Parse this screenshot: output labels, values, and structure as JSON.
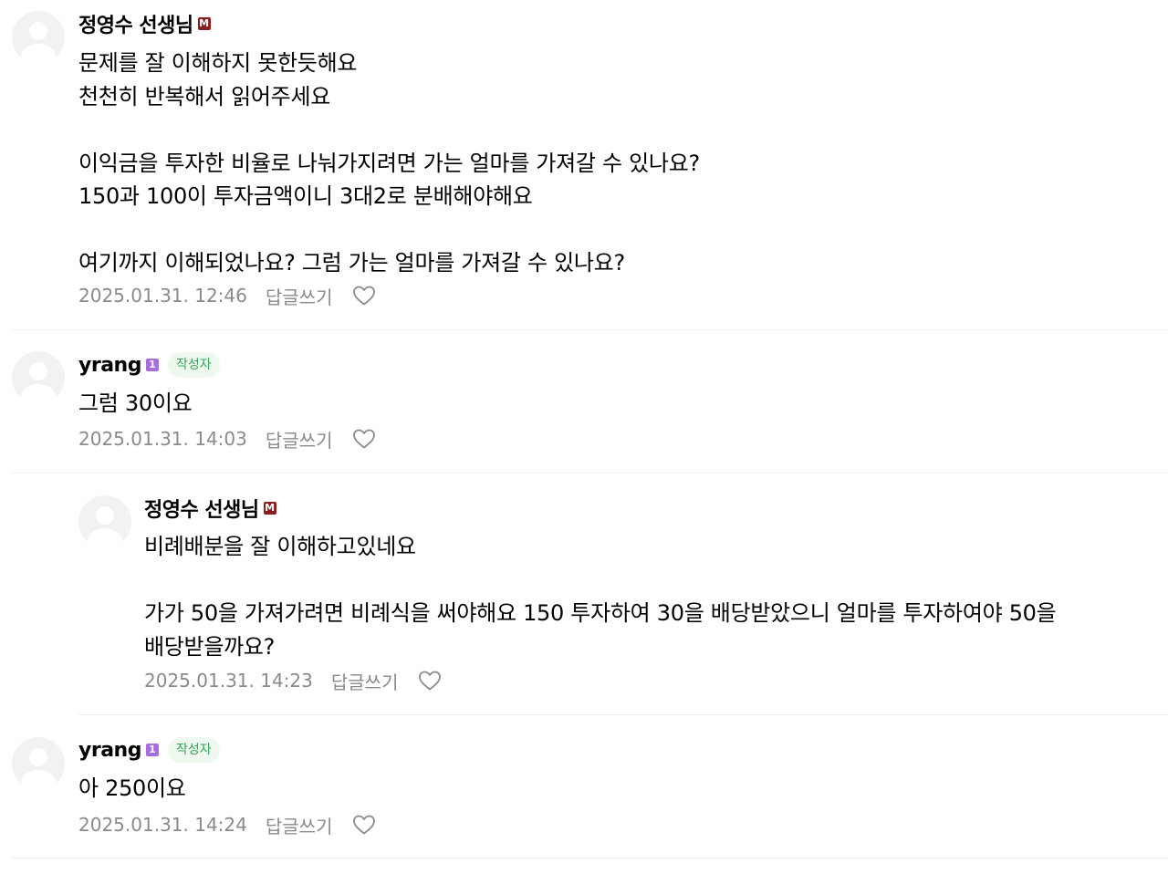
{
  "comments": [
    {
      "author": "정영수 선생님",
      "badge": "M",
      "body": "문제를 잘 이해하지 못한듯해요\n천천히 반복해서 읽어주세요\n\n이익금을 투자한 비율로 나눠가지려면 가는 얼마를 가져갈 수 있나요?\n150과 100이 투자금액이니 3대2로 분배해야해요\n\n여기까지 이해되었나요? 그럼 가는 얼마를 가져갈 수 있나요?",
      "date": "2025.01.31. 12:46",
      "reply_label": "답글쓰기"
    },
    {
      "author": "yrang",
      "badge": "1",
      "writer_tag": "작성자",
      "body": "그럼 30이요",
      "date": "2025.01.31. 14:03",
      "reply_label": "답글쓰기"
    },
    {
      "author": "정영수 선생님",
      "badge": "M",
      "body": "비례배분을 잘 이해하고있네요\n\n가가 50을 가져가려면 비례식을 써야해요 150 투자하여 30을 배당받았으니 얼마를 투자하여야 50을\n배당받을까요?",
      "date": "2025.01.31. 14:23",
      "reply_label": "답글쓰기"
    },
    {
      "author": "yrang",
      "badge": "1",
      "writer_tag": "작성자",
      "body": "아 250이요",
      "date": "2025.01.31. 14:24",
      "reply_label": "답글쓰기"
    }
  ],
  "icons": {
    "avatar": "default-profile-icon",
    "like": "heart-outline-icon"
  },
  "colors": {
    "manager_badge": "#8b1e1e",
    "level_badge": "#a66ddc",
    "writer_tag_text": "#3aa35a",
    "writer_tag_bg": "#eef8ef",
    "meta_text": "#8a8a8a"
  }
}
